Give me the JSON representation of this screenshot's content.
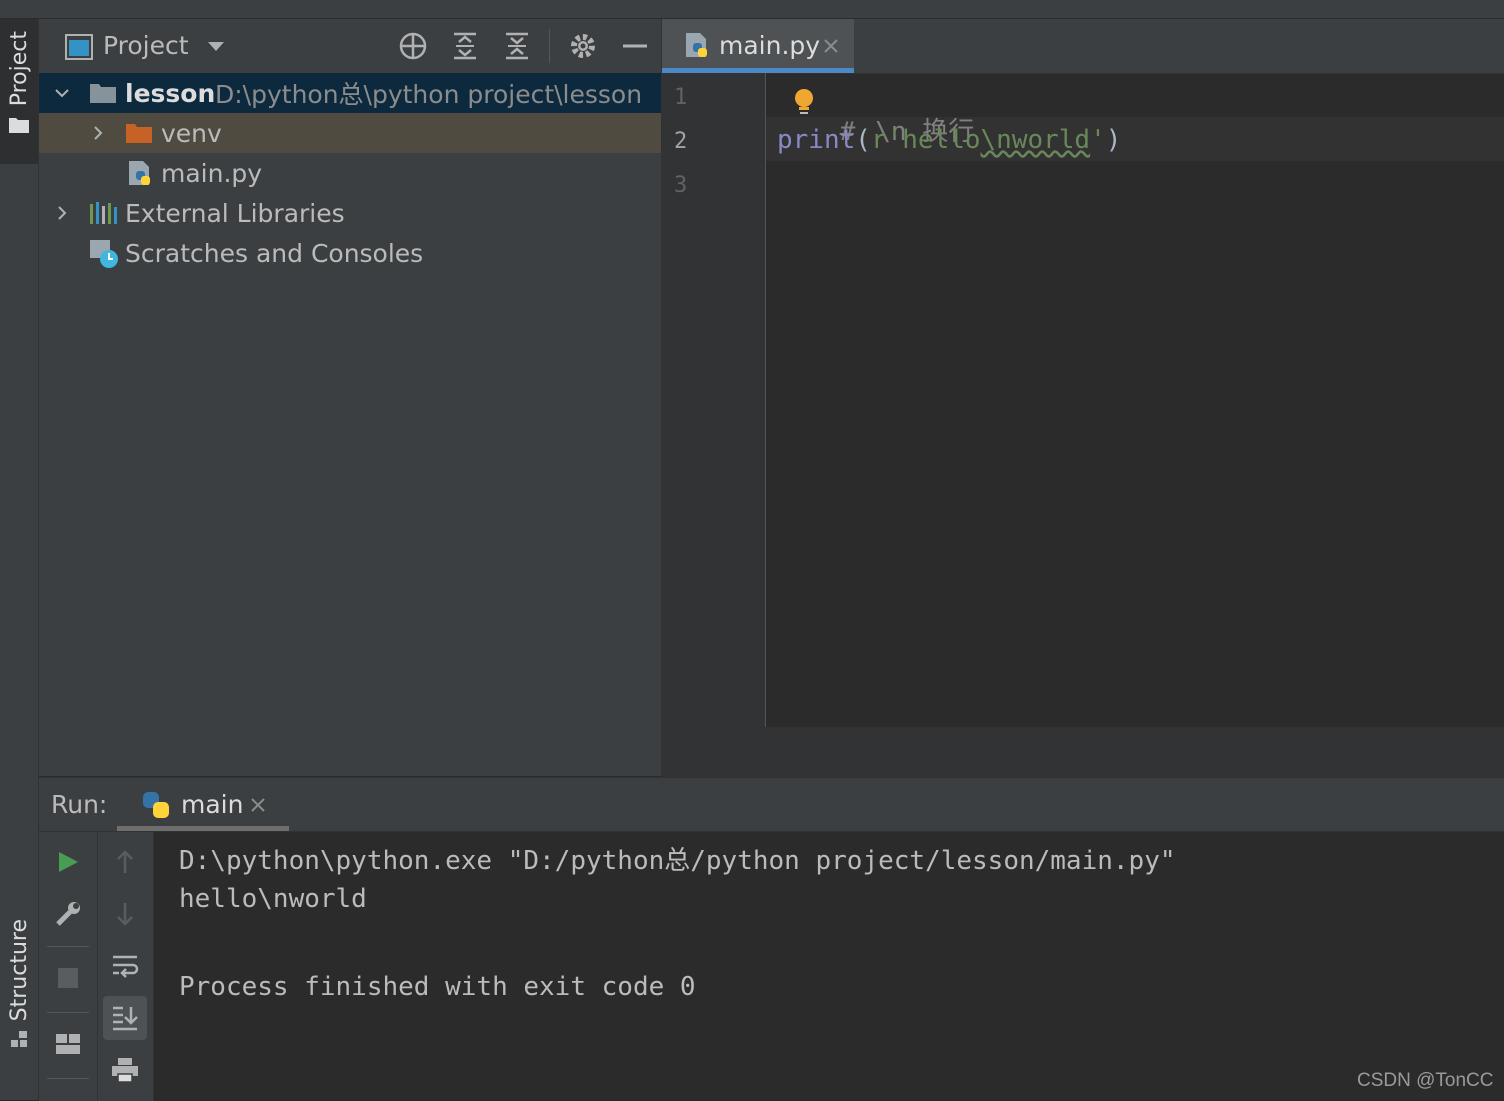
{
  "project_panel": {
    "title": "Project",
    "tree": {
      "root_name": "lesson",
      "root_path": "D:\\python总\\python project\\lesson",
      "venv": "venv",
      "main_file": "main.py",
      "external_libraries": "External Libraries",
      "scratches": "Scratches and Consoles"
    }
  },
  "left_strip": {
    "project_tab": "Project",
    "structure_tab": "Structure"
  },
  "editor": {
    "tab_label": "main.py",
    "line_numbers": [
      "1",
      "2",
      "3"
    ],
    "line1": {
      "hash": "#",
      "rest": "\\n 换行"
    },
    "line2": {
      "fn": "print",
      "open": "(",
      "prefix": "r",
      "str_a": "'hello",
      "str_b": "\\nworld",
      "str_c": "'",
      "close": ")"
    }
  },
  "run_panel": {
    "label": "Run:",
    "tab_label": "main",
    "output": [
      "D:\\python\\python.exe \"D:/python总/python project/lesson/main.py\"",
      "hello\\nworld",
      "",
      "Process finished with exit code 0"
    ]
  },
  "watermark": "CSDN @TonCC",
  "colors": {
    "panel_bg": "#3c3f41",
    "editor_bg": "#2b2b2b",
    "selection": "#0d293e",
    "venv_row": "#4f4b41",
    "keyword_print": "#8888c6",
    "string": "#6a8759",
    "comment": "#808080",
    "run_green": "#499c54",
    "tab_underline": "#4a88c7"
  }
}
